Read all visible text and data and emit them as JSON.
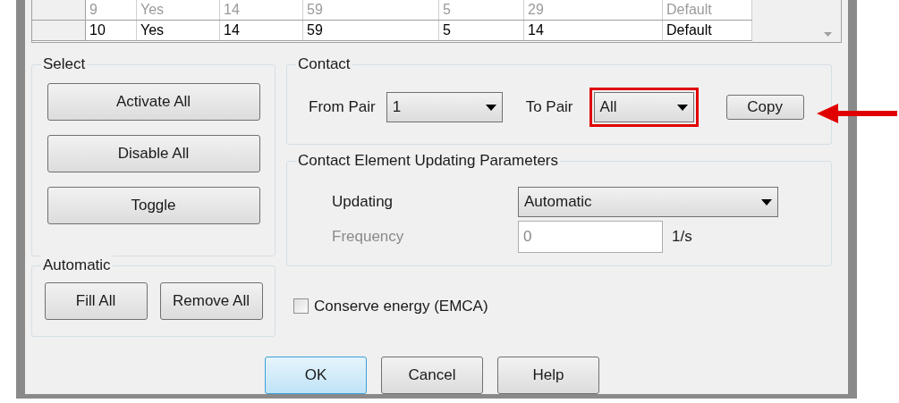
{
  "table": {
    "rows": [
      {
        "disabled": true,
        "cells": [
          "9",
          "Yes",
          "14",
          "59",
          "5",
          "29",
          "Default"
        ]
      },
      {
        "disabled": false,
        "cells": [
          "10",
          "Yes",
          "14",
          "59",
          "5",
          "14",
          "Default"
        ]
      }
    ]
  },
  "select_group": {
    "title": "Select",
    "buttons": [
      "Activate All",
      "Disable All",
      "Toggle"
    ]
  },
  "automatic_group": {
    "title": "Automatic",
    "buttons": [
      "Fill All",
      "Remove All"
    ]
  },
  "contact_group": {
    "title": "Contact",
    "from_pair": {
      "label": "From Pair",
      "value": "1"
    },
    "to_pair": {
      "label": "To Pair",
      "value": "All",
      "highlighted": true
    },
    "copy_button": {
      "label": "Copy",
      "pointed_at": true
    }
  },
  "updating_group": {
    "title": "Contact Element Updating Parameters",
    "updating": {
      "label": "Updating",
      "value": "Automatic"
    },
    "frequency": {
      "label": "Frequency",
      "value": "0",
      "unit": "1/s",
      "disabled": true
    }
  },
  "conserve_energy": {
    "label": "Conserve energy (EMCA)",
    "checked": false
  },
  "footer_buttons": [
    {
      "label": "OK",
      "default": true
    },
    {
      "label": "Cancel",
      "default": false
    },
    {
      "label": "Help",
      "default": false
    }
  ]
}
